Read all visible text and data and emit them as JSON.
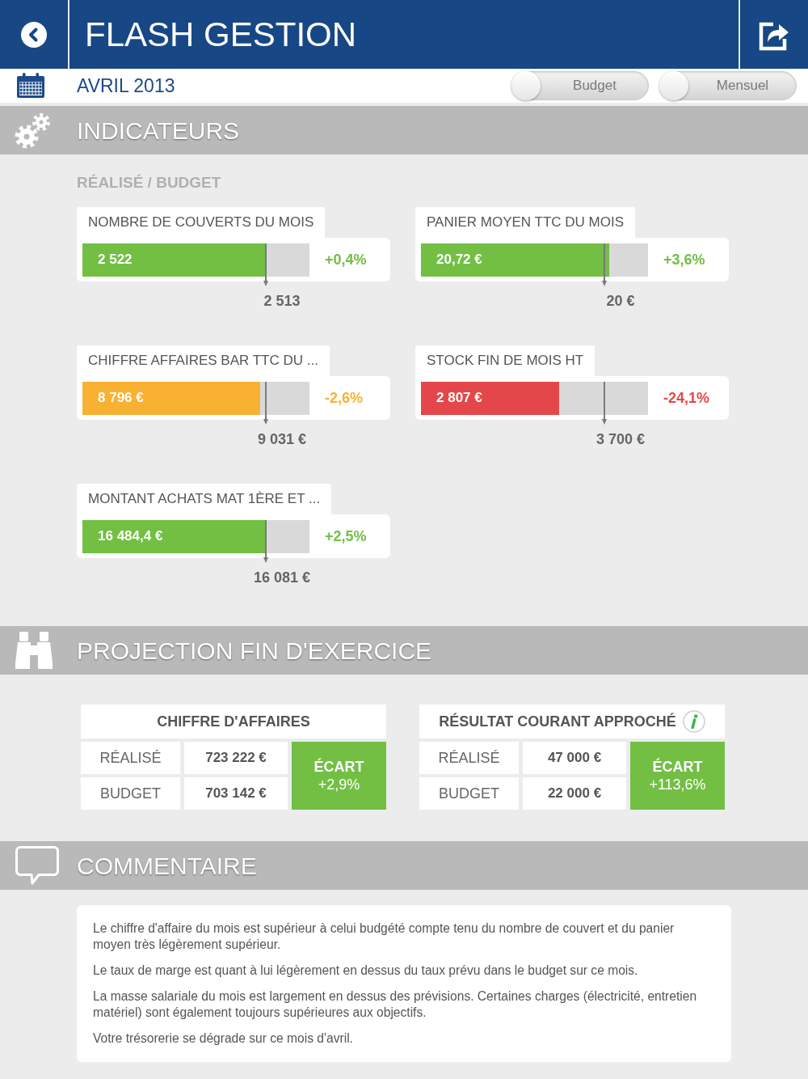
{
  "header": {
    "title": "FLASH GESTION"
  },
  "toolbar": {
    "period": "AVRIL 2013",
    "toggles": [
      {
        "label": "Budget",
        "on": false
      },
      {
        "label": "Mensuel",
        "on": false
      }
    ]
  },
  "indicators": {
    "title": "INDICATEURS",
    "subtitle": "RÉALISÉ / BUDGET",
    "items": [
      {
        "label": "NOMBRE DE COUVERTS DU MOIS",
        "value": "2 522",
        "level": 0.813,
        "color": "#72bf44",
        "change": "+0,4%",
        "budget": "2 513"
      },
      {
        "label": "PANIER MOYEN TTC DU MOIS",
        "value": "20,72 €",
        "level": 0.83,
        "color": "#72bf44",
        "change": "+3,6%",
        "budget": "20 €"
      },
      {
        "label": "CHIFFRE AFFAIRES BAR TTC DU ...",
        "value": "8 796 €",
        "level": 0.783,
        "color": "#f8b133",
        "change": "-2,6%",
        "budget": "9 031 €"
      },
      {
        "label": "STOCK FIN DE MOIS HT",
        "value": "2 807 €",
        "level": 0.609,
        "color": "#e4474a",
        "change": "-24,1%",
        "budget": "3 700 €"
      },
      {
        "label": "MONTANT ACHATS MAT 1ÈRE ET ...",
        "value": "16 484,4 €",
        "level": 0.812,
        "color": "#72bf44",
        "change": "+2,5%",
        "budget": "16 081 €"
      }
    ]
  },
  "projection": {
    "title": "PROJECTION FIN D'EXERCICE",
    "cards": [
      {
        "title": "CHIFFRE D'AFFAIRES",
        "info": false,
        "rows": [
          {
            "label": "RÉALISÉ",
            "value": "723 222 €"
          },
          {
            "label": "BUDGET",
            "value": "703 142 €"
          }
        ],
        "variance": {
          "label": "ÉCART",
          "value": "+2,9%"
        }
      },
      {
        "title": "RÉSULTAT COURANT APPROCHÉ",
        "info": true,
        "rows": [
          {
            "label": "RÉALISÉ",
            "value": "47 000 €"
          },
          {
            "label": "BUDGET",
            "value": "22 000 €"
          }
        ],
        "variance": {
          "label": "ÉCART",
          "value": "+113,6%"
        }
      }
    ]
  },
  "comment": {
    "title": "COMMENTAIRE",
    "paragraphs": [
      "Le chiffre d'affaire du mois est supérieur à celui budgété compte tenu du nombre de couvert et du panier moyen très légèrement supérieur.",
      "Le taux de marge est quant à lui légèrement en dessus du taux prévu dans le budget sur ce mois.",
      "La masse salariale du mois est largement en dessus des prévisions. Certaines charges (électricité, entretien matériel) sont également toujours supérieures aux objectifs.",
      "Votre trésorerie se dégrade sur ce mois d'avril."
    ]
  }
}
